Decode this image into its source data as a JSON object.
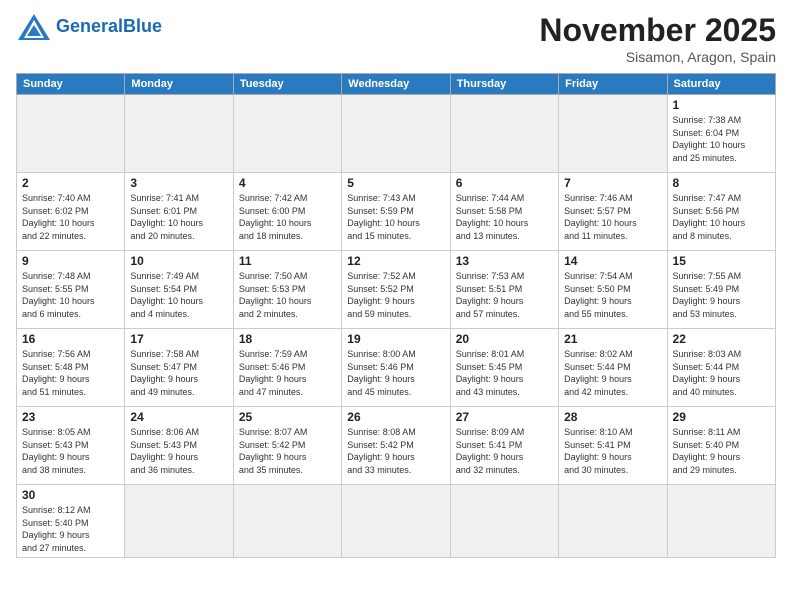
{
  "header": {
    "logo_general": "General",
    "logo_blue": "Blue",
    "month_title": "November 2025",
    "location": "Sisamon, Aragon, Spain"
  },
  "weekdays": [
    "Sunday",
    "Monday",
    "Tuesday",
    "Wednesday",
    "Thursday",
    "Friday",
    "Saturday"
  ],
  "weeks": [
    [
      {
        "day": "",
        "empty": true
      },
      {
        "day": "",
        "empty": true
      },
      {
        "day": "",
        "empty": true
      },
      {
        "day": "",
        "empty": true
      },
      {
        "day": "",
        "empty": true
      },
      {
        "day": "",
        "empty": true
      },
      {
        "day": "1",
        "info": "Sunrise: 7:38 AM\nSunset: 6:04 PM\nDaylight: 10 hours\nand 25 minutes."
      }
    ],
    [
      {
        "day": "2",
        "info": "Sunrise: 7:40 AM\nSunset: 6:02 PM\nDaylight: 10 hours\nand 22 minutes."
      },
      {
        "day": "3",
        "info": "Sunrise: 7:41 AM\nSunset: 6:01 PM\nDaylight: 10 hours\nand 20 minutes."
      },
      {
        "day": "4",
        "info": "Sunrise: 7:42 AM\nSunset: 6:00 PM\nDaylight: 10 hours\nand 18 minutes."
      },
      {
        "day": "5",
        "info": "Sunrise: 7:43 AM\nSunset: 5:59 PM\nDaylight: 10 hours\nand 15 minutes."
      },
      {
        "day": "6",
        "info": "Sunrise: 7:44 AM\nSunset: 5:58 PM\nDaylight: 10 hours\nand 13 minutes."
      },
      {
        "day": "7",
        "info": "Sunrise: 7:46 AM\nSunset: 5:57 PM\nDaylight: 10 hours\nand 11 minutes."
      },
      {
        "day": "8",
        "info": "Sunrise: 7:47 AM\nSunset: 5:56 PM\nDaylight: 10 hours\nand 8 minutes."
      }
    ],
    [
      {
        "day": "9",
        "info": "Sunrise: 7:48 AM\nSunset: 5:55 PM\nDaylight: 10 hours\nand 6 minutes."
      },
      {
        "day": "10",
        "info": "Sunrise: 7:49 AM\nSunset: 5:54 PM\nDaylight: 10 hours\nand 4 minutes."
      },
      {
        "day": "11",
        "info": "Sunrise: 7:50 AM\nSunset: 5:53 PM\nDaylight: 10 hours\nand 2 minutes."
      },
      {
        "day": "12",
        "info": "Sunrise: 7:52 AM\nSunset: 5:52 PM\nDaylight: 9 hours\nand 59 minutes."
      },
      {
        "day": "13",
        "info": "Sunrise: 7:53 AM\nSunset: 5:51 PM\nDaylight: 9 hours\nand 57 minutes."
      },
      {
        "day": "14",
        "info": "Sunrise: 7:54 AM\nSunset: 5:50 PM\nDaylight: 9 hours\nand 55 minutes."
      },
      {
        "day": "15",
        "info": "Sunrise: 7:55 AM\nSunset: 5:49 PM\nDaylight: 9 hours\nand 53 minutes."
      }
    ],
    [
      {
        "day": "16",
        "info": "Sunrise: 7:56 AM\nSunset: 5:48 PM\nDaylight: 9 hours\nand 51 minutes."
      },
      {
        "day": "17",
        "info": "Sunrise: 7:58 AM\nSunset: 5:47 PM\nDaylight: 9 hours\nand 49 minutes."
      },
      {
        "day": "18",
        "info": "Sunrise: 7:59 AM\nSunset: 5:46 PM\nDaylight: 9 hours\nand 47 minutes."
      },
      {
        "day": "19",
        "info": "Sunrise: 8:00 AM\nSunset: 5:46 PM\nDaylight: 9 hours\nand 45 minutes."
      },
      {
        "day": "20",
        "info": "Sunrise: 8:01 AM\nSunset: 5:45 PM\nDaylight: 9 hours\nand 43 minutes."
      },
      {
        "day": "21",
        "info": "Sunrise: 8:02 AM\nSunset: 5:44 PM\nDaylight: 9 hours\nand 42 minutes."
      },
      {
        "day": "22",
        "info": "Sunrise: 8:03 AM\nSunset: 5:44 PM\nDaylight: 9 hours\nand 40 minutes."
      }
    ],
    [
      {
        "day": "23",
        "info": "Sunrise: 8:05 AM\nSunset: 5:43 PM\nDaylight: 9 hours\nand 38 minutes."
      },
      {
        "day": "24",
        "info": "Sunrise: 8:06 AM\nSunset: 5:43 PM\nDaylight: 9 hours\nand 36 minutes."
      },
      {
        "day": "25",
        "info": "Sunrise: 8:07 AM\nSunset: 5:42 PM\nDaylight: 9 hours\nand 35 minutes."
      },
      {
        "day": "26",
        "info": "Sunrise: 8:08 AM\nSunset: 5:42 PM\nDaylight: 9 hours\nand 33 minutes."
      },
      {
        "day": "27",
        "info": "Sunrise: 8:09 AM\nSunset: 5:41 PM\nDaylight: 9 hours\nand 32 minutes."
      },
      {
        "day": "28",
        "info": "Sunrise: 8:10 AM\nSunset: 5:41 PM\nDaylight: 9 hours\nand 30 minutes."
      },
      {
        "day": "29",
        "info": "Sunrise: 8:11 AM\nSunset: 5:40 PM\nDaylight: 9 hours\nand 29 minutes."
      }
    ],
    [
      {
        "day": "30",
        "info": "Sunrise: 8:12 AM\nSunset: 5:40 PM\nDaylight: 9 hours\nand 27 minutes."
      },
      {
        "day": "",
        "empty": true
      },
      {
        "day": "",
        "empty": true
      },
      {
        "day": "",
        "empty": true
      },
      {
        "day": "",
        "empty": true
      },
      {
        "day": "",
        "empty": true
      },
      {
        "day": "",
        "empty": true
      }
    ]
  ]
}
